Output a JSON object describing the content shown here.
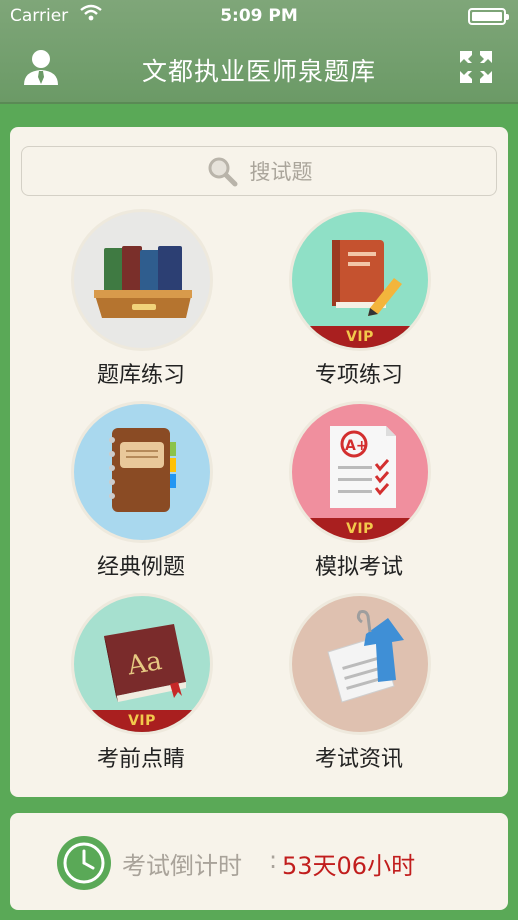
{
  "status_bar": {
    "carrier": "Carrier",
    "time": "5:09 PM"
  },
  "nav": {
    "title": "文都执业医师泉题库",
    "left_icon": "user-icon",
    "right_icon": "grid-icon"
  },
  "search": {
    "placeholder": "搜试题",
    "icon": "search-icon"
  },
  "tiles": [
    {
      "label": "题库练习",
      "icon": "books-tray-icon",
      "vip": false,
      "bg": "#e8e8e6"
    },
    {
      "label": "专项练习",
      "icon": "book-pencil-icon",
      "vip": true,
      "vip_label": "VIP",
      "bg": "#8fe0c6"
    },
    {
      "label": "经典例题",
      "icon": "notebook-icon",
      "vip": false,
      "bg": "#a9d8ee"
    },
    {
      "label": "模拟考试",
      "icon": "exam-paper-icon",
      "vip": true,
      "vip_label": "VIP",
      "bg": "#f08f9e"
    },
    {
      "label": "考前点睛",
      "icon": "dictionary-icon",
      "vip": true,
      "vip_label": "VIP",
      "bg": "#a6e0cf"
    },
    {
      "label": "考试资讯",
      "icon": "document-arrow-icon",
      "vip": false,
      "bg": "#dfc1b0"
    }
  ],
  "countdown": {
    "label": "考试倒计时",
    "separator": ":",
    "value": "53天06小时",
    "icon": "clock-icon"
  },
  "colors": {
    "background": "#5aa957",
    "nav": "#7fa679",
    "card": "#f7f3ea",
    "vip_band": "#a91f1f",
    "vip_text": "#f2c94c",
    "countdown_value": "#c11d1d"
  }
}
